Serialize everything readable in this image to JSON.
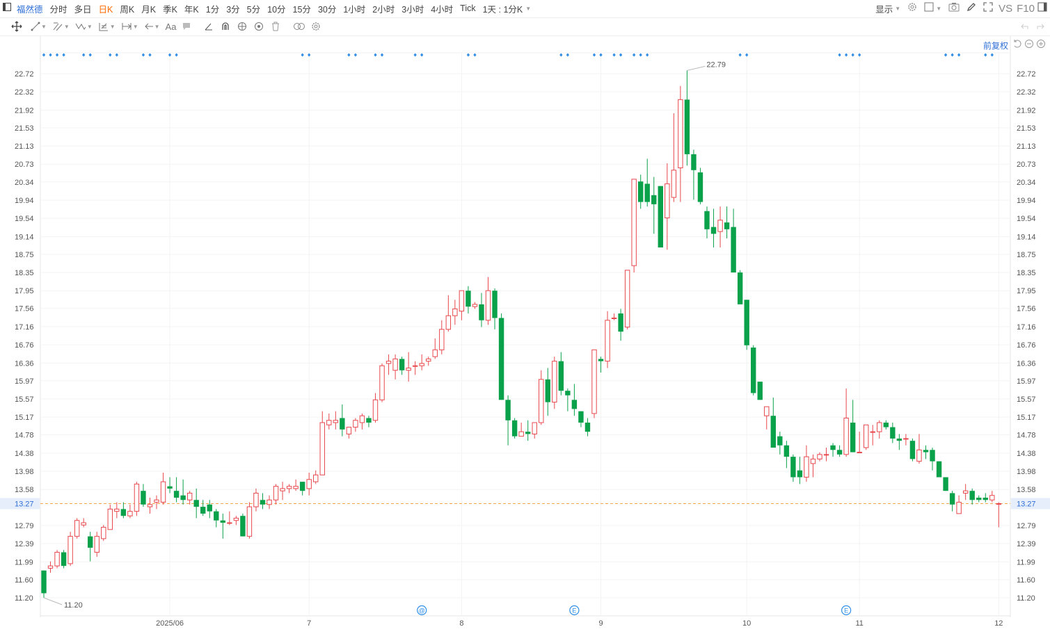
{
  "toolbar": {
    "stock_name": "福然德",
    "periods": [
      "分时",
      "多日",
      "日K",
      "周K",
      "月K",
      "季K",
      "年K",
      "1分",
      "3分",
      "5分",
      "10分",
      "15分",
      "30分",
      "1小时",
      "2小时",
      "3小时",
      "4小时",
      "Tick",
      "1天 : 1分K"
    ],
    "active_period": "日K",
    "display_label": "显示",
    "vs_label": "VS",
    "f10_label": "F10"
  },
  "drawing_tools": [
    "move-icon",
    "line-icon",
    "channel-icon",
    "pattern-icon",
    "fib-icon",
    "measure-icon",
    "arrow-icon",
    "text-icon",
    "comment-icon",
    "angle-icon",
    "magnet-icon",
    "eye-icon",
    "visibility-icon",
    "trash-icon",
    "compare-icon",
    "settings-icon"
  ],
  "adjust_label": "前复权",
  "colors": {
    "up": "#e8474c",
    "down": "#0aa14b",
    "price_line": "#f5a54b",
    "price_tag": "#e6eefc",
    "marker": "#2f8fe8"
  },
  "chart_data": {
    "type": "candlestick",
    "ylim": [
      11.2,
      22.72
    ],
    "y_ticks": [
      "22.72",
      "22.32",
      "21.92",
      "21.53",
      "21.13",
      "20.73",
      "20.34",
      "19.94",
      "19.54",
      "19.14",
      "18.75",
      "18.35",
      "17.95",
      "17.56",
      "17.16",
      "16.76",
      "16.36",
      "15.97",
      "15.57",
      "15.17",
      "14.78",
      "14.38",
      "13.98",
      "13.58",
      "12.79",
      "12.39",
      "11.99",
      "11.60",
      "11.20"
    ],
    "x_labels": [
      {
        "label": "2025/06",
        "index": 19
      },
      {
        "label": "7",
        "index": 40
      },
      {
        "label": "8",
        "index": 63
      },
      {
        "label": "9",
        "index": 84
      },
      {
        "label": "10",
        "index": 106
      },
      {
        "label": "11",
        "index": 123
      },
      {
        "label": "12",
        "index": 144
      }
    ],
    "current_price": "13.27",
    "max_label": "22.79",
    "min_label": "11.20",
    "event_markers": [
      {
        "symbol": "@",
        "index": 57
      },
      {
        "symbol": "E",
        "index": 80
      },
      {
        "symbol": "E",
        "index": 121
      }
    ],
    "dot_groups": [
      [
        0,
        1,
        2,
        3
      ],
      [
        6,
        7
      ],
      [
        10,
        11
      ],
      [
        15,
        16
      ],
      [
        19,
        20
      ],
      [
        39,
        40
      ],
      [
        46,
        47
      ],
      [
        50,
        51
      ],
      [
        56,
        57
      ],
      [
        64,
        65
      ],
      [
        78,
        79
      ],
      [
        83,
        84
      ],
      [
        86,
        87
      ],
      [
        89,
        90,
        91
      ],
      [
        105,
        106
      ],
      [
        120,
        121,
        122,
        123
      ],
      [
        136,
        137,
        138
      ],
      [
        142,
        143
      ]
    ],
    "ohlc": [
      [
        11.8,
        11.8,
        11.2,
        11.3
      ],
      [
        11.85,
        12.0,
        11.75,
        11.9
      ],
      [
        11.9,
        12.25,
        11.85,
        12.2
      ],
      [
        12.2,
        12.25,
        11.85,
        11.9
      ],
      [
        11.95,
        12.65,
        11.9,
        12.55
      ],
      [
        12.55,
        12.95,
        12.5,
        12.9
      ],
      [
        12.8,
        12.95,
        12.75,
        12.85
      ],
      [
        12.55,
        12.65,
        12.0,
        12.3
      ],
      [
        12.2,
        12.65,
        12.1,
        12.55
      ],
      [
        12.5,
        12.8,
        12.45,
        12.75
      ],
      [
        12.7,
        13.25,
        12.7,
        13.15
      ],
      [
        13.1,
        13.3,
        12.95,
        13.15
      ],
      [
        13.15,
        13.3,
        12.95,
        13.0
      ],
      [
        13.0,
        13.25,
        12.95,
        13.1
      ],
      [
        13.1,
        13.75,
        13.0,
        13.7
      ],
      [
        13.55,
        13.7,
        13.2,
        13.25
      ],
      [
        13.2,
        13.4,
        13.05,
        13.25
      ],
      [
        13.3,
        13.45,
        13.15,
        13.35
      ],
      [
        13.3,
        13.95,
        13.25,
        13.75
      ],
      [
        13.65,
        13.85,
        13.5,
        13.6
      ],
      [
        13.55,
        13.85,
        13.3,
        13.4
      ],
      [
        13.45,
        13.8,
        13.25,
        13.35
      ],
      [
        13.35,
        13.55,
        13.25,
        13.5
      ],
      [
        13.35,
        13.6,
        12.95,
        13.2
      ],
      [
        13.2,
        13.35,
        13.0,
        13.05
      ],
      [
        13.25,
        13.35,
        12.95,
        13.1
      ],
      [
        13.1,
        13.15,
        12.75,
        12.9
      ],
      [
        12.9,
        13.05,
        12.5,
        12.85
      ],
      [
        12.85,
        13.1,
        12.8,
        12.85
      ],
      [
        12.9,
        13.0,
        12.8,
        12.95
      ],
      [
        13.0,
        13.05,
        12.55,
        12.55
      ],
      [
        12.55,
        13.3,
        12.5,
        13.2
      ],
      [
        13.2,
        13.6,
        13.1,
        13.5
      ],
      [
        13.35,
        13.5,
        13.15,
        13.25
      ],
      [
        13.25,
        13.45,
        13.15,
        13.35
      ],
      [
        13.35,
        13.7,
        13.25,
        13.65
      ],
      [
        13.55,
        13.75,
        13.35,
        13.6
      ],
      [
        13.6,
        13.7,
        13.5,
        13.65
      ],
      [
        13.6,
        13.8,
        13.55,
        13.65
      ],
      [
        13.75,
        13.75,
        13.45,
        13.55
      ],
      [
        13.6,
        13.95,
        13.45,
        13.8
      ],
      [
        13.75,
        14.0,
        13.7,
        13.9
      ],
      [
        13.9,
        15.3,
        13.9,
        15.05
      ],
      [
        15.0,
        15.25,
        14.9,
        15.1
      ],
      [
        15.05,
        15.3,
        14.9,
        15.1
      ],
      [
        15.15,
        15.45,
        14.75,
        14.9
      ],
      [
        14.8,
        14.95,
        14.7,
        14.95
      ],
      [
        14.95,
        15.15,
        14.85,
        15.1
      ],
      [
        15.05,
        15.25,
        14.9,
        15.2
      ],
      [
        15.15,
        15.2,
        14.95,
        15.05
      ],
      [
        15.1,
        15.7,
        15.05,
        15.55
      ],
      [
        15.55,
        16.35,
        15.5,
        16.3
      ],
      [
        16.35,
        16.55,
        16.1,
        16.4
      ],
      [
        16.2,
        16.55,
        16.0,
        16.45
      ],
      [
        16.45,
        16.5,
        16.1,
        16.2
      ],
      [
        16.2,
        16.6,
        15.95,
        16.25
      ],
      [
        16.3,
        16.4,
        16.1,
        16.3
      ],
      [
        16.3,
        16.55,
        16.2,
        16.35
      ],
      [
        16.4,
        16.5,
        16.3,
        16.45
      ],
      [
        16.5,
        16.9,
        16.45,
        16.65
      ],
      [
        16.65,
        17.3,
        16.55,
        17.1
      ],
      [
        17.1,
        17.85,
        17.05,
        17.4
      ],
      [
        17.4,
        17.75,
        17.2,
        17.55
      ],
      [
        17.5,
        17.95,
        17.3,
        17.95
      ],
      [
        17.95,
        18.05,
        17.45,
        17.6
      ],
      [
        17.6,
        17.7,
        17.55,
        17.65
      ],
      [
        17.65,
        17.9,
        17.15,
        17.3
      ],
      [
        17.3,
        18.25,
        17.2,
        17.95
      ],
      [
        17.95,
        18.0,
        17.1,
        17.35
      ],
      [
        17.35,
        17.45,
        15.55,
        15.55
      ],
      [
        15.55,
        15.65,
        14.55,
        15.1
      ],
      [
        15.1,
        15.15,
        14.7,
        14.75
      ],
      [
        14.75,
        15.05,
        14.75,
        14.85
      ],
      [
        14.85,
        15.1,
        14.65,
        14.8
      ],
      [
        14.8,
        15.0,
        14.7,
        15.05
      ],
      [
        15.05,
        16.2,
        15.0,
        16.0
      ],
      [
        16.0,
        16.25,
        15.2,
        15.5
      ],
      [
        15.5,
        16.5,
        15.35,
        16.4
      ],
      [
        16.4,
        16.6,
        15.65,
        15.75
      ],
      [
        15.75,
        15.8,
        15.3,
        15.65
      ],
      [
        15.55,
        15.9,
        15.2,
        15.35
      ],
      [
        15.3,
        15.3,
        14.95,
        15.05
      ],
      [
        15.05,
        15.15,
        14.75,
        14.85
      ],
      [
        15.25,
        16.05,
        15.15,
        16.65
      ],
      [
        16.45,
        16.5,
        16.15,
        16.4
      ],
      [
        16.4,
        17.5,
        16.25,
        17.3
      ],
      [
        17.35,
        17.45,
        17.3,
        17.35
      ],
      [
        17.45,
        17.55,
        16.85,
        17.05
      ],
      [
        17.15,
        18.3,
        17.1,
        18.4
      ],
      [
        18.5,
        20.4,
        18.35,
        20.4
      ],
      [
        20.35,
        20.5,
        19.75,
        19.9
      ],
      [
        20.3,
        20.85,
        19.8,
        19.9
      ],
      [
        20.05,
        20.45,
        19.2,
        19.85
      ],
      [
        20.25,
        20.25,
        18.95,
        18.9
      ],
      [
        19.55,
        20.75,
        18.85,
        20.3
      ],
      [
        20.0,
        21.85,
        19.9,
        20.6
      ],
      [
        20.65,
        22.45,
        19.9,
        22.15
      ],
      [
        22.15,
        22.79,
        20.7,
        20.95
      ],
      [
        20.95,
        21.05,
        19.95,
        20.6
      ],
      [
        20.55,
        20.65,
        19.85,
        19.9
      ],
      [
        19.7,
        19.8,
        19.1,
        19.3
      ],
      [
        19.35,
        19.75,
        18.9,
        19.2
      ],
      [
        19.25,
        19.8,
        18.9,
        19.5
      ],
      [
        19.45,
        19.8,
        19.1,
        19.3
      ],
      [
        19.35,
        19.75,
        18.65,
        18.35
      ],
      [
        18.35,
        18.4,
        17.7,
        17.65
      ],
      [
        17.75,
        17.75,
        16.65,
        16.75
      ],
      [
        16.7,
        16.75,
        15.65,
        15.7
      ],
      [
        15.95,
        15.95,
        15.55,
        15.55
      ],
      [
        15.2,
        15.35,
        14.9,
        15.4
      ],
      [
        15.2,
        15.6,
        14.5,
        14.5
      ],
      [
        14.75,
        14.85,
        14.35,
        14.55
      ],
      [
        14.55,
        14.65,
        14.05,
        14.3
      ],
      [
        14.3,
        14.35,
        13.75,
        13.85
      ],
      [
        14.0,
        14.3,
        13.7,
        13.85
      ],
      [
        13.85,
        14.55,
        13.75,
        14.3
      ],
      [
        14.15,
        14.35,
        13.85,
        14.25
      ],
      [
        14.25,
        14.4,
        14.2,
        14.35
      ],
      [
        14.35,
        14.5,
        14.2,
        14.35
      ],
      [
        14.55,
        14.6,
        14.3,
        14.45
      ],
      [
        14.45,
        14.55,
        14.3,
        14.35
      ],
      [
        14.35,
        15.8,
        14.3,
        15.15
      ],
      [
        15.05,
        15.55,
        14.4,
        14.4
      ],
      [
        14.4,
        14.85,
        14.4,
        14.4
      ],
      [
        14.5,
        14.95,
        14.45,
        15.0
      ],
      [
        14.85,
        15.0,
        14.55,
        14.85
      ],
      [
        14.85,
        15.1,
        14.7,
        15.05
      ],
      [
        15.05,
        15.1,
        14.9,
        14.95
      ],
      [
        14.95,
        15.05,
        14.6,
        14.7
      ],
      [
        14.7,
        14.8,
        14.45,
        14.65
      ],
      [
        14.7,
        14.8,
        14.55,
        14.7
      ],
      [
        14.65,
        14.7,
        14.2,
        14.25
      ],
      [
        14.2,
        14.8,
        14.15,
        14.45
      ],
      [
        14.45,
        14.55,
        14.25,
        14.4
      ],
      [
        14.45,
        14.5,
        14.0,
        14.2
      ],
      [
        14.2,
        14.2,
        13.85,
        13.85
      ],
      [
        13.85,
        13.85,
        13.55,
        13.55
      ],
      [
        13.5,
        13.55,
        13.1,
        13.25
      ],
      [
        13.05,
        13.45,
        13.05,
        13.3
      ],
      [
        13.5,
        13.7,
        13.35,
        13.55
      ],
      [
        13.55,
        13.6,
        13.25,
        13.35
      ],
      [
        13.4,
        13.45,
        13.3,
        13.35
      ],
      [
        13.4,
        13.5,
        13.3,
        13.35
      ],
      [
        13.35,
        13.55,
        13.3,
        13.45
      ],
      [
        13.27,
        13.3,
        12.75,
        13.27
      ]
    ]
  }
}
